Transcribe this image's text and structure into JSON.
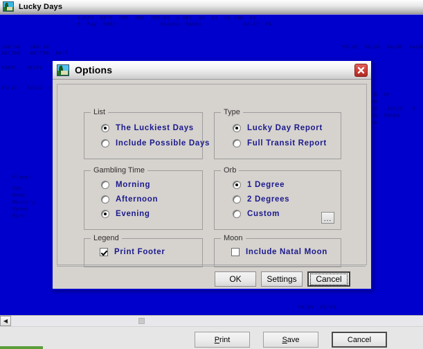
{
  "app": {
    "title": "Lucky Days",
    "icon": "palm-tree-icon",
    "report": {
      "header": "LUCKY  DAYS  FOR  THE  PERIOD  1 DEC  93  to  31 JAN  94",
      "subheader": "6  May  1961              Susana  Ramos             22-37  PA",
      "col_left": "JAN 94   JAN 94\nRR/TRN   RR/TRN  RR/T",
      "col_mid": "MARPL   VELPL   VE/T",
      "col_dates": "03/12   03/12  03/",
      "planet_heading": "Planet",
      "planet_list": "Sun\nMoon\nMercury\nVenus\nMars",
      "right_top": "VALUE  VALUE  VALUE  VALUE  V",
      "right_block": "VE/TR  VE\nTR/SU\n21/12   22/12   2\nVEnSA  VEnSA\nVEnSA",
      "bottom_right": "TR/SU  VE/TR"
    },
    "scrollbar": {
      "left_arrow_icon": "chevron-left-icon"
    },
    "buttons": {
      "print": "Print",
      "print_mnemonic": "P",
      "save": "Save",
      "save_mnemonic": "S",
      "cancel": "Cancel"
    }
  },
  "dialog": {
    "title": "Options",
    "icon": "palm-tree-icon",
    "close_icon": "close-icon",
    "groups": {
      "list": {
        "legend": "List",
        "options": [
          {
            "label": "The Luckiest Days",
            "checked": true
          },
          {
            "label": "Include Possible Days",
            "checked": false
          }
        ]
      },
      "type": {
        "legend": "Type",
        "options": [
          {
            "label": "Lucky Day Report",
            "checked": true
          },
          {
            "label": "Full Transit Report",
            "checked": false
          }
        ]
      },
      "gambling_time": {
        "legend": "Gambling Time",
        "options": [
          {
            "label": "Morning",
            "checked": false
          },
          {
            "label": "Afternoon",
            "checked": false
          },
          {
            "label": "Evening",
            "checked": true
          }
        ]
      },
      "orb": {
        "legend": "Orb",
        "options": [
          {
            "label": "1 Degree",
            "checked": true
          },
          {
            "label": "2 Degrees",
            "checked": false
          },
          {
            "label": "Custom",
            "checked": false
          }
        ],
        "browse_label": "...",
        "browse_icon": "ellipsis-icon"
      },
      "legend_group": {
        "legend": "Legend",
        "options": [
          {
            "label": "Print Footer",
            "checked": true
          }
        ]
      },
      "moon": {
        "legend": "Moon",
        "options": [
          {
            "label": "Include Natal Moon",
            "checked": false
          }
        ]
      }
    },
    "buttons": {
      "ok": "OK",
      "settings": "Settings",
      "cancel": "Cancel"
    }
  },
  "colors": {
    "canvas_blue": "#0000cc",
    "option_label": "#1a1a8c",
    "dialog_face": "#d6d2ce",
    "dialog_border": "#0000c8",
    "close_red": "#cf3f38"
  }
}
